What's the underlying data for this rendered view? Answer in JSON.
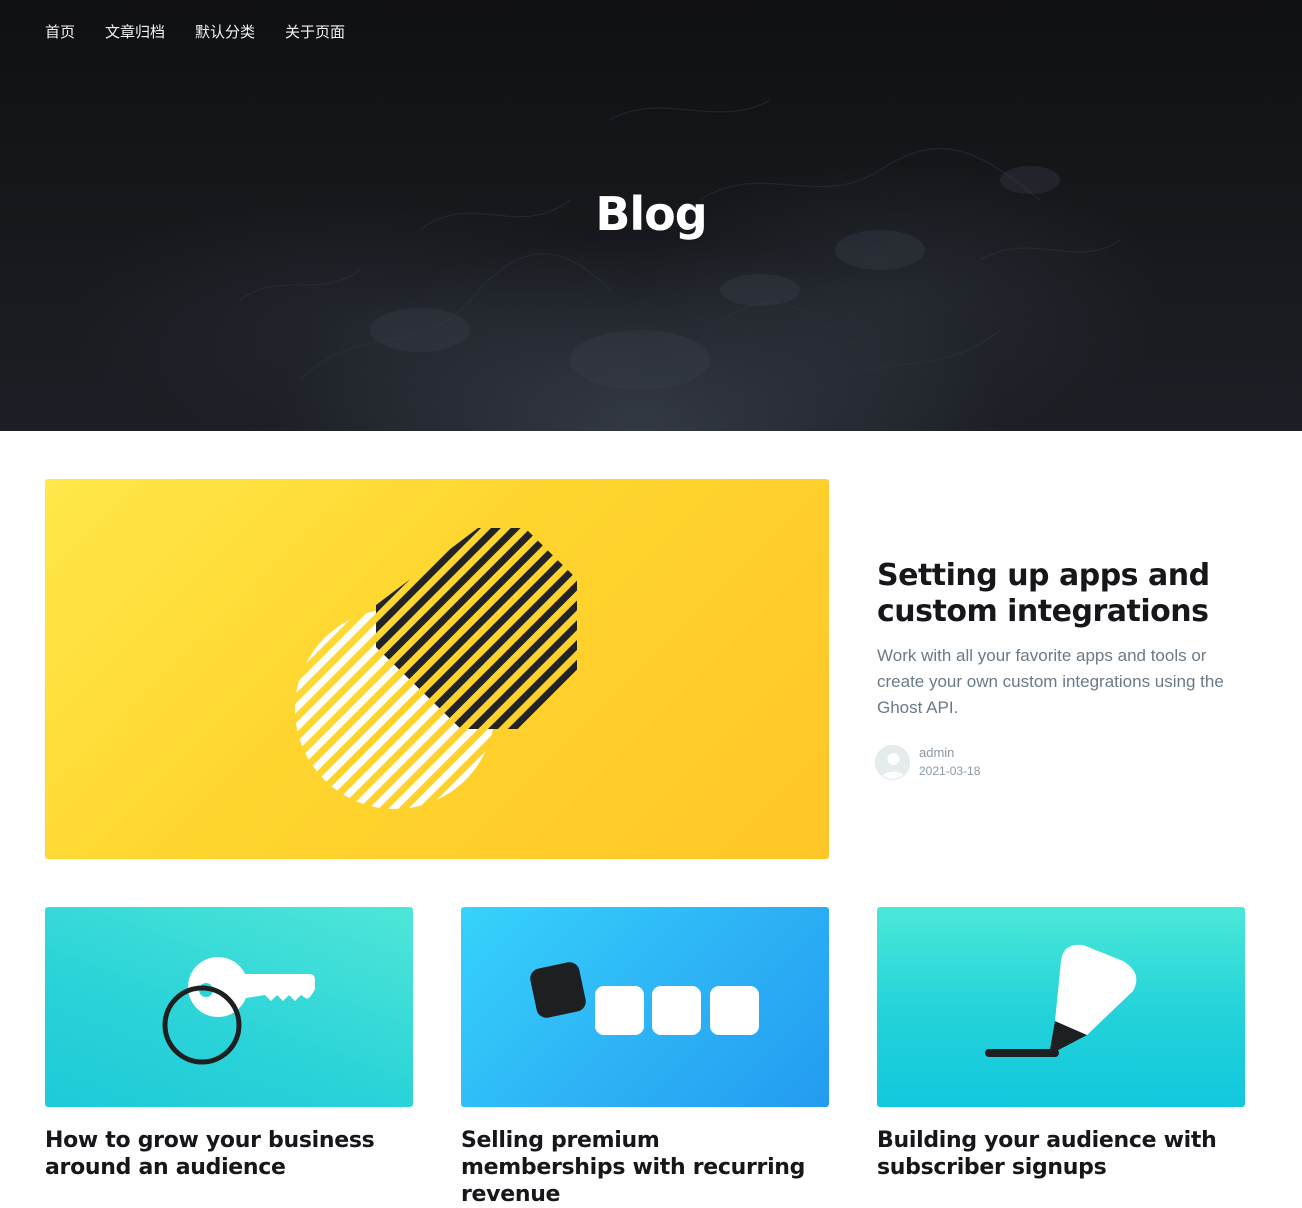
{
  "nav": {
    "items": [
      {
        "label": "首页"
      },
      {
        "label": "文章归档"
      },
      {
        "label": "默认分类"
      },
      {
        "label": "关于页面"
      }
    ]
  },
  "hero": {
    "title": "Blog"
  },
  "featured": {
    "title": "Setting up apps and custom integrations",
    "excerpt": "Work with all your favorite apps and tools or create your own custom integrations using the Ghost API.",
    "author": "admin",
    "date": "2021-03-18",
    "image_icon": "overlapping-striped-circles-icon",
    "image_color": "#ffd52e"
  },
  "cards": [
    {
      "title": "How to grow your business around an audience",
      "image_icon": "key-ring-icon",
      "image_color": "#2ad3d8"
    },
    {
      "title": "Selling premium memberships with recurring revenue",
      "image_icon": "squares-row-icon",
      "image_color": "#2eb5f6"
    },
    {
      "title": "Building your audience with subscriber signups",
      "image_icon": "marker-pen-icon",
      "image_color": "#22d2da"
    }
  ]
}
